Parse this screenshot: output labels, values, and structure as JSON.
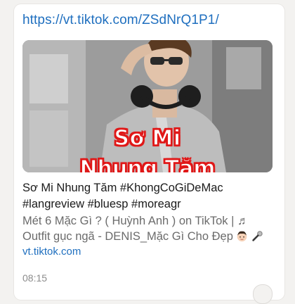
{
  "message": {
    "url": "https://vt.tiktok.com/ZSdNrQ1P1/",
    "preview": {
      "overlay_line1": "Sơ Mi",
      "overlay_line2": "Nhung Tăm"
    },
    "title_line1": "Sơ Mi Nhung Tăm #KhongCoGiDeMac",
    "title_line2": "#langreview #bluesp #moreagr",
    "description_line1": "Mét 6 Mặc Gì ? ( Huỳnh Anh ) on TikTok | ♬",
    "description_line2": "Outfit gục ngã - DENIS_Mặc Gì Cho Đẹp",
    "domain": "vt.tiktok.com",
    "time": "08:15"
  },
  "icons": {
    "music": "music-note-icon",
    "face": "boy-face-emoji-icon",
    "mic": "microphone-emoji-icon",
    "react": "reaction-button-icon"
  },
  "colors": {
    "link": "#1f6fbf",
    "overlay_text_stroke": "#e01818",
    "background": "#f3f2f0"
  }
}
